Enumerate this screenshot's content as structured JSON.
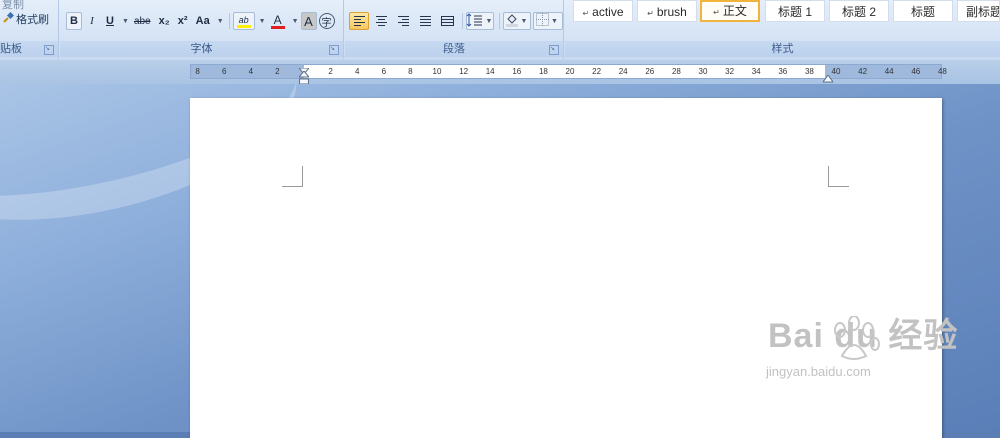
{
  "clipboard": {
    "copy_label_partial": "复制",
    "format_painter_label": "格式刷",
    "group_label_partial": "贴板"
  },
  "font_group": {
    "label": "字体",
    "bold": "B",
    "italic": "I",
    "underline": "U",
    "strikethrough": "abe",
    "subscript": "x₂",
    "superscript": "x²",
    "change_case": "Aa",
    "highlight": "ab",
    "font_color": "A",
    "char_shading": "A",
    "enclose_char": "字"
  },
  "paragraph_group": {
    "label": "段落"
  },
  "styles_group": {
    "label": "样式",
    "items": [
      {
        "label": "active",
        "mark": "↵"
      },
      {
        "label": "brush",
        "mark": "↵"
      },
      {
        "label": "正文",
        "mark": "↵"
      },
      {
        "label": "标题 1",
        "mark": ""
      },
      {
        "label": "标题 2",
        "mark": ""
      },
      {
        "label": "标题",
        "mark": ""
      },
      {
        "label": "副标题",
        "mark": ""
      }
    ],
    "selected_index": 2
  },
  "ruler": {
    "left_ticks": [
      "8",
      "6",
      "4",
      "2"
    ],
    "right_ticks": [
      "2",
      "4",
      "6",
      "8",
      "10",
      "12",
      "14",
      "16",
      "18",
      "20",
      "22",
      "24",
      "26",
      "28",
      "30",
      "32",
      "34",
      "36",
      "38",
      "40",
      "42",
      "44",
      "46",
      "48"
    ]
  },
  "watermark": {
    "logo": "Bai du 经验",
    "url": "jingyan.baidu.com"
  },
  "colors": {
    "accent_highlight": "#f2b33d",
    "font_color_bar": "#e21e1e",
    "highlight_bar": "#ffef00"
  }
}
